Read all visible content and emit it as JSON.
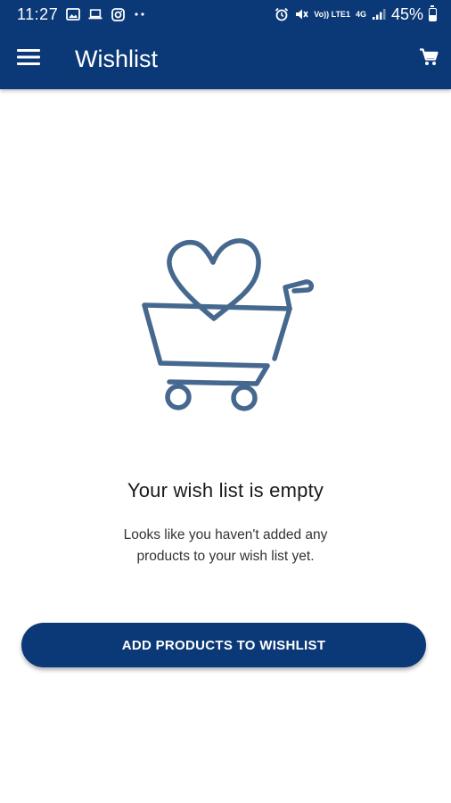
{
  "status_bar": {
    "time": "11:27",
    "battery_text": "45%",
    "battery_level": 0.45,
    "network_label": "Vo)) LTE1",
    "network_type": "4G",
    "left_icons": [
      "image-icon",
      "laptop-icon",
      "instagram-icon",
      "more-dots-icon"
    ],
    "right_icons": [
      "alarm-icon",
      "mute-icon",
      "signal-icon",
      "battery-icon"
    ]
  },
  "app_bar": {
    "title": "Wishlist",
    "menu_icon": "hamburger-menu-icon",
    "cart_icon": "shopping-cart-icon"
  },
  "empty_state": {
    "illustration": "heart-in-cart-icon",
    "title": "Your wish list is empty",
    "message_line1": "Looks like you haven't added any",
    "message_line2": "products to your wish list yet."
  },
  "actions": {
    "add_products_label": "ADD PRODUCTS TO WISHLIST"
  },
  "colors": {
    "brand": "#0b3977",
    "illustration": "#46688f",
    "background": "#ffffff",
    "text_primary": "#1a1a1a",
    "text_secondary": "#333333"
  }
}
